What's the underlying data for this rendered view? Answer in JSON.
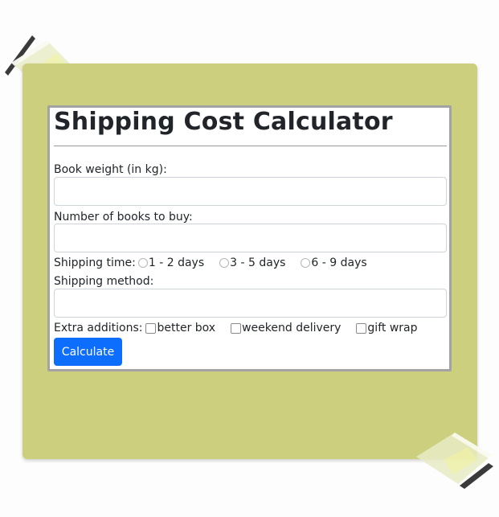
{
  "page": {
    "title": "Shipping Cost Calculator"
  },
  "form": {
    "weight_label": "Book weight (in kg):",
    "count_label": "Number of books to buy:",
    "shipping_time_label": "Shipping time:",
    "shipping_time_options": [
      "1 - 2 days",
      "3 - 5 days",
      "6 - 9 days"
    ],
    "shipping_method_label": "Shipping method:",
    "extras_label": "Extra additions:",
    "extras_options": [
      "better box",
      "weekend delivery",
      "gift wrap"
    ],
    "submit_label": "Calculate"
  },
  "colors": {
    "board": "#cccf7d",
    "button": "#0d6efd"
  }
}
